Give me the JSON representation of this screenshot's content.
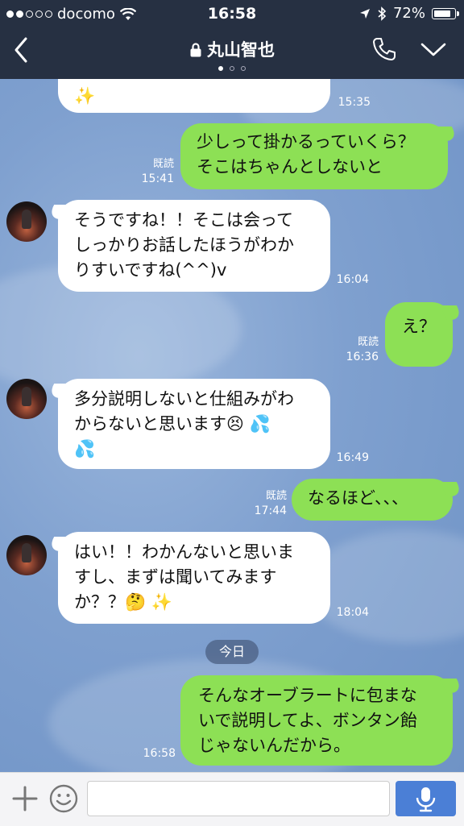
{
  "status_bar": {
    "carrier": "docomo",
    "time": "16:58",
    "battery": "72%"
  },
  "header": {
    "title": "丸山智也",
    "page_indicator": {
      "count": 3,
      "active": 0
    }
  },
  "messages": [
    {
      "side": "in",
      "text": "✨",
      "time": "15:35"
    },
    {
      "side": "out",
      "text": "少しって掛かるっていくら？\nそこはちゃんとしないと",
      "read": "既読",
      "time": "15:41"
    },
    {
      "side": "in",
      "text": "そうですね！！そこは会って\nしっかりお話したほうがわか\nりすいですね(^^)v",
      "time": "16:04"
    },
    {
      "side": "out",
      "text": "え？",
      "read": "既読",
      "time": "16:36"
    },
    {
      "side": "in",
      "text": "多分説明しないと仕組みがわ\nからないと思います😣 💦\n💦",
      "time": "16:49"
    },
    {
      "side": "out",
      "text": "なるほど、、、",
      "read": "既読",
      "time": "17:44"
    },
    {
      "side": "in",
      "text": "はい！！わかんないと思いま\nすし、まずは聞いてみます\nか？？🤔 ✨",
      "time": "18:04"
    },
    {
      "side": "out",
      "text": "そんなオーブラートに包まな\nいで説明してよ、ボンタン飴\nじゃないんだから。",
      "time": "16:58"
    }
  ],
  "date_divider": "今日",
  "input": {
    "placeholder": "",
    "value": ""
  },
  "icons": {
    "back": "chevron-left-icon",
    "lock": "lock-icon",
    "call": "phone-icon",
    "menu": "chevron-down-icon",
    "add": "plus-icon",
    "emoji": "smiley-icon",
    "voice": "mic-icon"
  },
  "colors": {
    "header_bg": "#263042",
    "chat_bg": "#7d9fcf",
    "outgoing_bubble": "#8de055",
    "incoming_bubble": "#ffffff",
    "mic_button": "#4b7fd6"
  }
}
